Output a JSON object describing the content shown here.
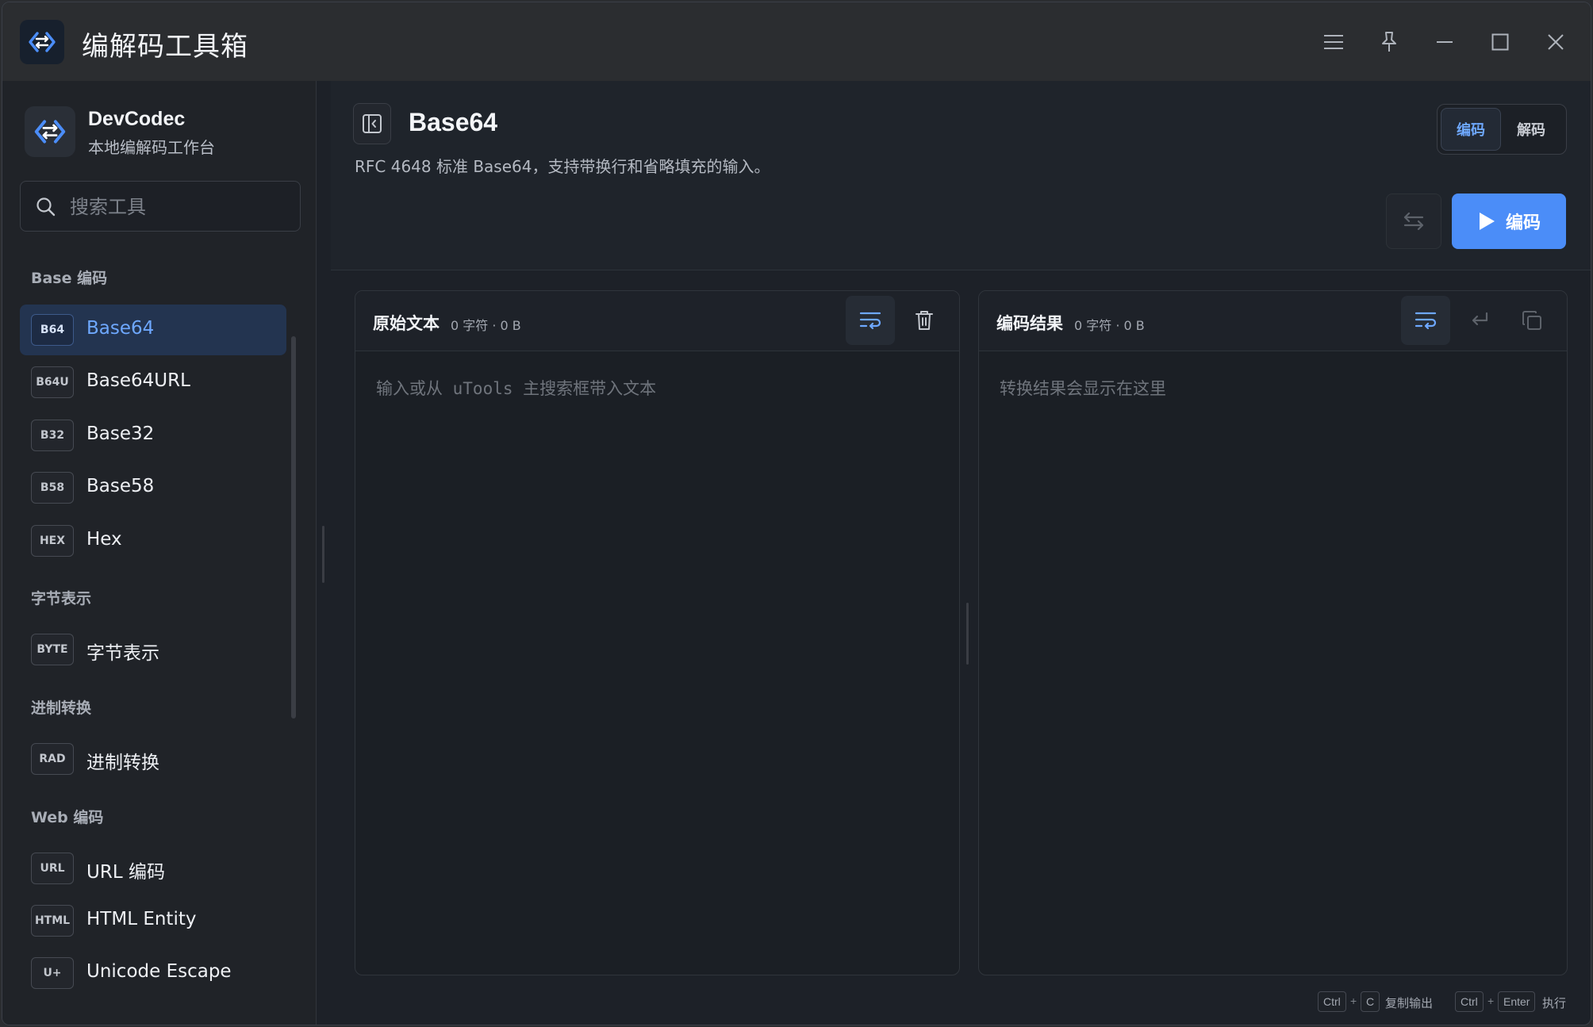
{
  "titlebar": {
    "title": "编解码工具箱",
    "controls": [
      "menu-icon",
      "pin-icon",
      "minimize-icon",
      "maximize-icon",
      "close-icon"
    ]
  },
  "sidebar": {
    "brand_name": "DevCodec",
    "brand_sub": "本地编解码工作台",
    "search_placeholder": "搜索工具",
    "groups": [
      {
        "label": "Base 编码",
        "items": [
          {
            "badge": "B64",
            "label": "Base64",
            "active": true
          },
          {
            "badge": "B64U",
            "label": "Base64URL"
          },
          {
            "badge": "B32",
            "label": "Base32"
          },
          {
            "badge": "B58",
            "label": "Base58"
          },
          {
            "badge": "HEX",
            "label": "Hex"
          }
        ]
      },
      {
        "label": "字节表示",
        "items": [
          {
            "badge": "BYTE",
            "label": "字节表示"
          }
        ]
      },
      {
        "label": "进制转换",
        "items": [
          {
            "badge": "RAD",
            "label": "进制转换"
          }
        ]
      },
      {
        "label": "Web 编码",
        "items": [
          {
            "badge": "URL",
            "label": "URL 编码"
          },
          {
            "badge": "HTML",
            "label": "HTML Entity"
          },
          {
            "badge": "U+",
            "label": "Unicode Escape"
          }
        ]
      }
    ]
  },
  "header": {
    "title": "Base64",
    "description": "RFC 4648 标准 Base64，支持带换行和省略填充的输入。",
    "mode_encode": "编码",
    "mode_decode": "解码",
    "run_label": "编码"
  },
  "input_panel": {
    "title": "原始文本",
    "meta": "0 字符 · 0 B",
    "placeholder": "输入或从 uTools 主搜索框带入文本",
    "value": ""
  },
  "output_panel": {
    "title": "编码结果",
    "meta": "0 字符 · 0 B",
    "placeholder": "转换结果会显示在这里",
    "value": ""
  },
  "hints": {
    "copy_keys": [
      "Ctrl",
      "C"
    ],
    "copy_label": "复制输出",
    "run_keys": [
      "Ctrl",
      "Enter"
    ],
    "run_label": "执行"
  },
  "colors": {
    "accent": "#4b8df8",
    "active_text": "#6ea8ff",
    "active_bg": "#233450"
  }
}
